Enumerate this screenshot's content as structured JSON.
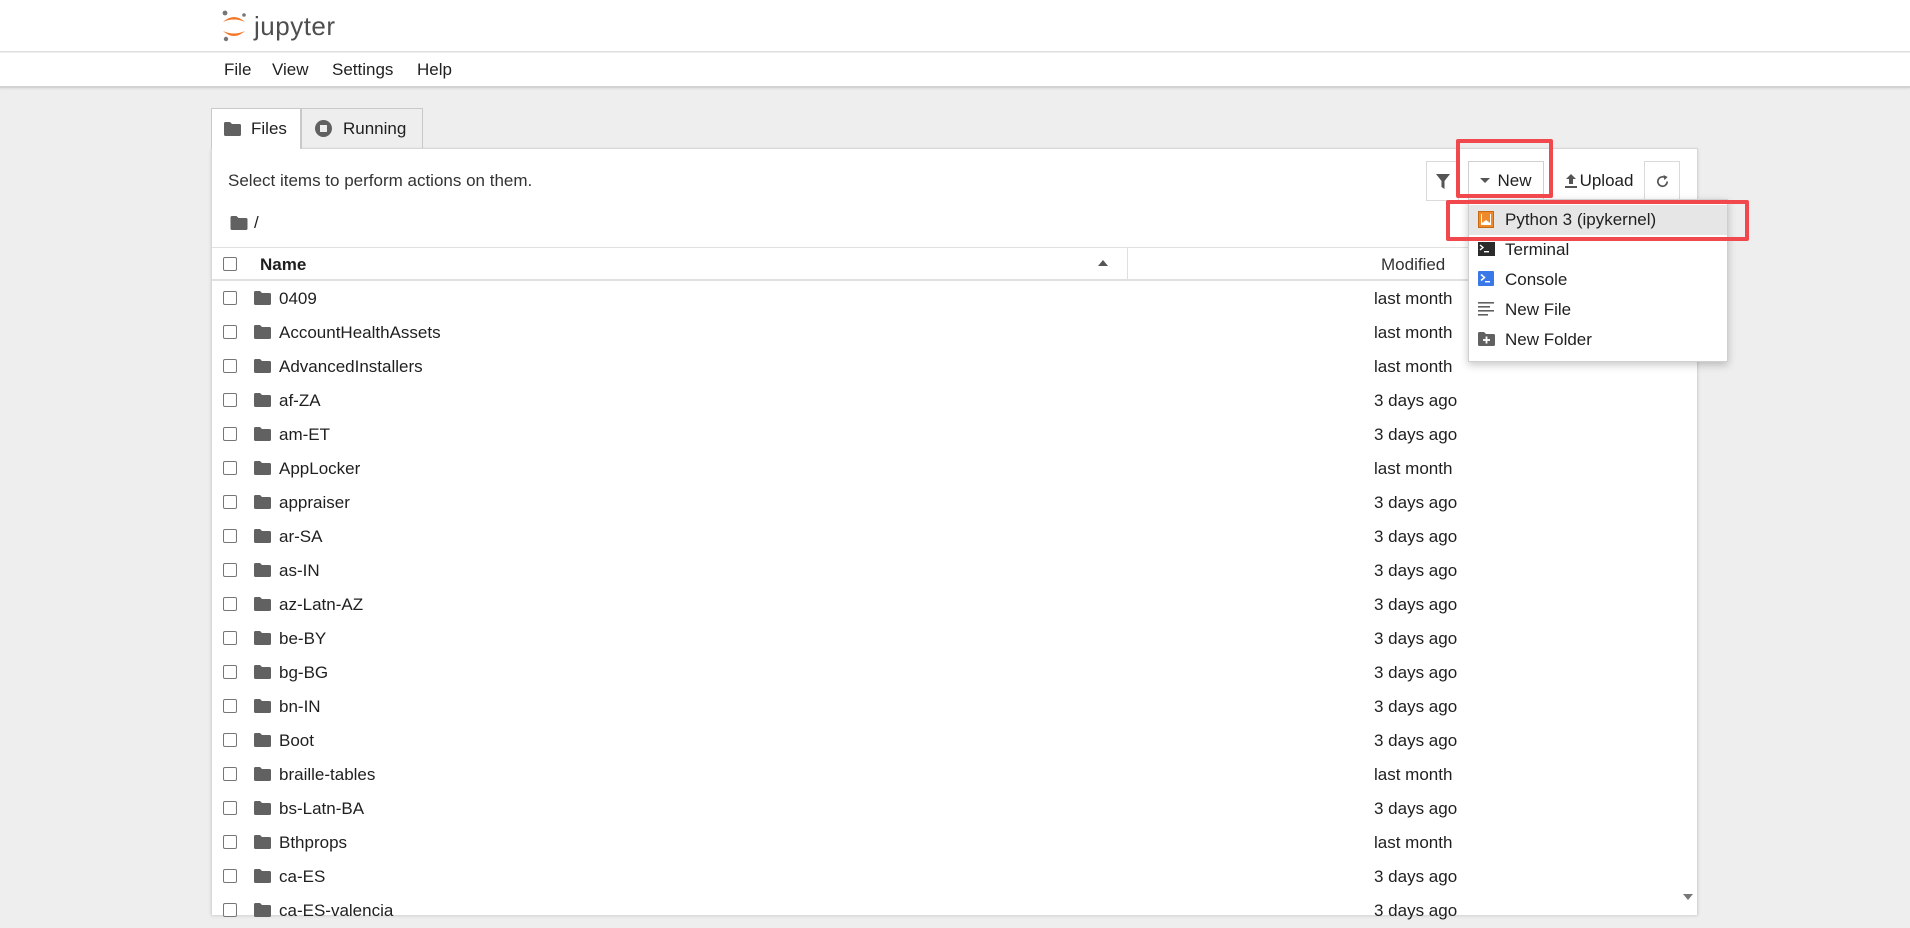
{
  "app": {
    "logo_text": "jupyter"
  },
  "menubar": {
    "items": [
      "File",
      "View",
      "Settings",
      "Help"
    ]
  },
  "tabs": [
    {
      "label": "Files",
      "icon": "folder-icon",
      "active": true
    },
    {
      "label": "Running",
      "icon": "stop-circle-icon",
      "active": false
    }
  ],
  "toolbar": {
    "hint": "Select items to perform actions on them.",
    "filter_icon": "filter-icon",
    "new_label": "New",
    "upload_label": "Upload",
    "refresh_icon": "refresh-icon"
  },
  "breadcrumb": {
    "path": "/"
  },
  "list": {
    "name_header": "Name",
    "modified_header": "Modified",
    "rows": [
      {
        "name": "0409",
        "modified": "last month"
      },
      {
        "name": "AccountHealthAssets",
        "modified": "last month"
      },
      {
        "name": "AdvancedInstallers",
        "modified": "last month"
      },
      {
        "name": "af-ZA",
        "modified": "3 days ago"
      },
      {
        "name": "am-ET",
        "modified": "3 days ago"
      },
      {
        "name": "AppLocker",
        "modified": "last month"
      },
      {
        "name": "appraiser",
        "modified": "3 days ago"
      },
      {
        "name": "ar-SA",
        "modified": "3 days ago"
      },
      {
        "name": "as-IN",
        "modified": "3 days ago"
      },
      {
        "name": "az-Latn-AZ",
        "modified": "3 days ago"
      },
      {
        "name": "be-BY",
        "modified": "3 days ago"
      },
      {
        "name": "bg-BG",
        "modified": "3 days ago"
      },
      {
        "name": "bn-IN",
        "modified": "3 days ago"
      },
      {
        "name": "Boot",
        "modified": "3 days ago"
      },
      {
        "name": "braille-tables",
        "modified": "last month"
      },
      {
        "name": "bs-Latn-BA",
        "modified": "3 days ago"
      },
      {
        "name": "Bthprops",
        "modified": "last month"
      },
      {
        "name": "ca-ES",
        "modified": "3 days ago"
      },
      {
        "name": "ca-ES-valencia",
        "modified": "3 days ago"
      }
    ]
  },
  "new_menu": {
    "items": [
      {
        "label": "Python 3 (ipykernel)",
        "icon": "python-notebook-icon"
      },
      {
        "label": "Terminal",
        "icon": "terminal-icon"
      },
      {
        "label": "Console",
        "icon": "console-icon"
      },
      {
        "label": "New File",
        "icon": "text-file-icon"
      },
      {
        "label": "New Folder",
        "icon": "new-folder-icon"
      }
    ]
  },
  "colors": {
    "highlight": "#f0484d",
    "logo_orange": "#f37726",
    "python_icon": "#ef8a2b",
    "console_icon": "#3b78e7"
  }
}
